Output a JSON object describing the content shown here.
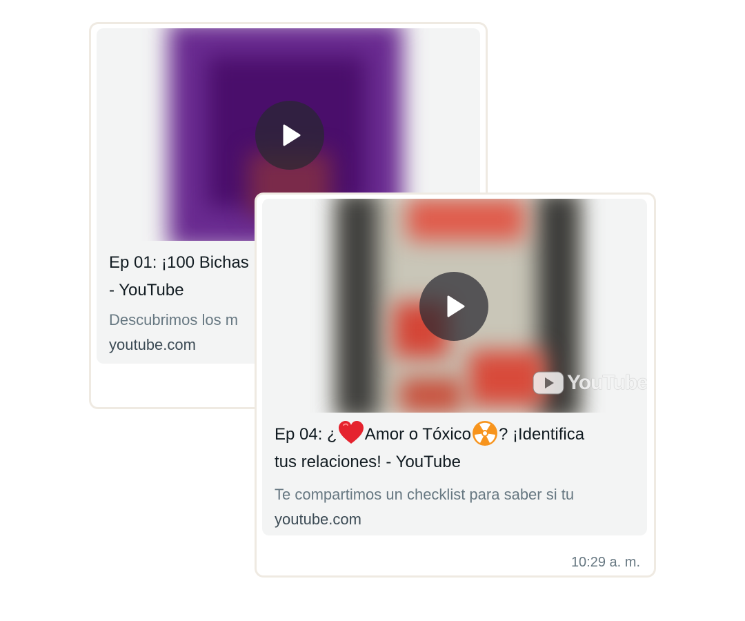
{
  "messages": [
    {
      "title_line1": "Ep 01: ¡100 Bichas",
      "title_line2": "- YouTube",
      "description": "Descubrimos los m",
      "domain": "youtube.com",
      "thumbnail_colors": [
        "#6a2b91",
        "#4b0f6e",
        "#7c3aa6"
      ]
    },
    {
      "title_prefix": "Ep 04: ¿",
      "title_middle": "Amor o Tóxico",
      "title_suffix": "? ¡Identifica",
      "title_line2": "tus relaciones! - YouTube",
      "description": "Te compartimos un checklist para saber si tu",
      "domain": "youtube.com",
      "time": "10:29 a. m.",
      "watermark": "YouTube",
      "emoji_1": "heart-emoji",
      "emoji_2": "radioactive-emoji",
      "thumbnail_colors": [
        "#c9c6b8",
        "#d84a3a",
        "#3e3e3c"
      ]
    }
  ],
  "icons": {
    "play": "play-icon",
    "youtube": "youtube-logo-icon"
  },
  "colors": {
    "bubble_bg": "#ffffff",
    "card_bg": "#f3f4f4",
    "chat_bg": "#efeae2",
    "meta_text": "#667781"
  }
}
